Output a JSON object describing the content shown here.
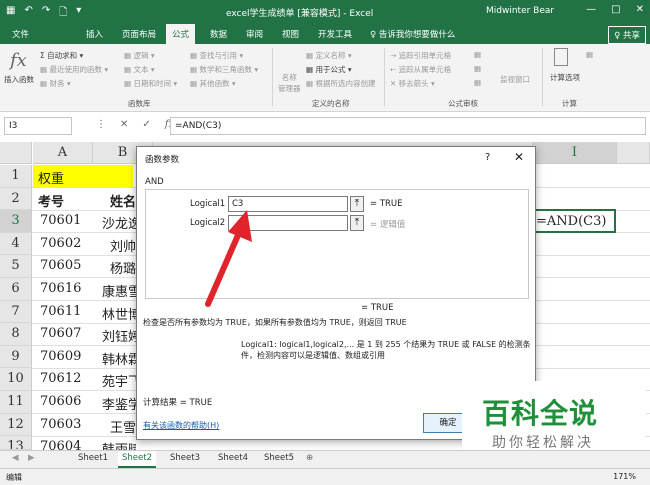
{
  "window": {
    "title": "excel学生成绩单 [兼容模式] - Excel",
    "user": "Midwinter Bear",
    "controls": [
      "—",
      "□",
      "✕"
    ]
  },
  "quick_access": [
    "▦",
    "↶",
    "↷",
    "🗋",
    "▾"
  ],
  "tabs": [
    "文件",
    "插入",
    "页面布局",
    "公式",
    "数据",
    "审阅",
    "视图",
    "开发工具"
  ],
  "active_tab": "公式",
  "tell_me": "♀ 告诉我你想要做什么",
  "share": "♀ 共享",
  "ribbon": {
    "insert_fn": {
      "icon": "fx",
      "label": "插入函数"
    },
    "lib": [
      "Σ 自动求和 ▾",
      "▦ 最近使用的函数 ▾",
      "▦ 财务 ▾",
      "▦ 逻辑 ▾",
      "▦ 文本 ▾",
      "▦ 日期和时间 ▾",
      "▦ 查找与引用 ▾",
      "▦ 数学和三角函数 ▾",
      "▦ 其他函数 ▾"
    ],
    "lib_group": "函数库",
    "name_manager": "名称\n管理器",
    "names": [
      "▦ 定义名称 ▾",
      "▦ 用于公式 ▾",
      "▦ 根据所选内容创建"
    ],
    "names_group": "定义的名称",
    "audit": [
      "⇢ 追踪引用单元格",
      "⇠ 追踪从属单元格",
      "✕ 移去箭头 ▾",
      "▦",
      "▦",
      "▦"
    ],
    "audit_group": "公式审核",
    "watch": "监视窗口",
    "calc_options": "计算选项",
    "calc_group": "计算"
  },
  "namebox": "I3",
  "fx_icons": [
    "⋮",
    "✕",
    "✓",
    "fx"
  ],
  "formula": "=AND(C3)",
  "columns": [
    "A",
    "B",
    "I"
  ],
  "rows": [
    "1",
    "2",
    "3",
    "4",
    "5",
    "6",
    "7",
    "8",
    "9",
    "10",
    "11",
    "12",
    "13"
  ],
  "row1": {
    "a": "权重"
  },
  "header_row": {
    "a": "考号",
    "b": "姓名"
  },
  "data_rows": [
    {
      "a": "70601",
      "b": "沙龙逸"
    },
    {
      "a": "70602",
      "b": "刘帅"
    },
    {
      "a": "70605",
      "b": "杨璐"
    },
    {
      "a": "70616",
      "b": "康惠雪"
    },
    {
      "a": "70611",
      "b": "林世博"
    },
    {
      "a": "70607",
      "b": "刘钰婷"
    },
    {
      "a": "70609",
      "b": "韩林霖"
    },
    {
      "a": "70612",
      "b": "苑宇飞"
    },
    {
      "a": "70606",
      "b": "李鉴学"
    },
    {
      "a": "70603",
      "b": "王雪"
    },
    {
      "a": "70604",
      "b": "韩雨晴"
    }
  ],
  "active_cell": "=AND(C3)",
  "dialog": {
    "title": "函数参数",
    "help": "?",
    "close": "✕",
    "function_name": "AND",
    "args": [
      {
        "label": "Logical1",
        "value": "C3",
        "result": "= TRUE"
      },
      {
        "label": "Logical2",
        "value": "",
        "result": "= 逻辑值"
      }
    ],
    "result_line": "= TRUE",
    "description": "检查是否所有参数均为 TRUE，如果所有参数值均为 TRUE，则返回 TRUE",
    "arg_desc_label": "Logical1:",
    "arg_desc": "logical1,logical2,... 是 1 到 255 个结果为 TRUE 或 FALSE 的检测条件，检测内容可以是逻辑值、数组或引用",
    "calc_result": "计算结果 =  TRUE",
    "help_link": "有关该函数的帮助(H)",
    "ok": "确定"
  },
  "watermark": {
    "title": "百科全说",
    "subtitle": "助你轻松解决"
  },
  "sheet_tabs": [
    "Sheet1",
    "Sheet2",
    "Sheet3",
    "Sheet4",
    "Sheet5"
  ],
  "active_sheet": "Sheet2",
  "status": {
    "mode": "编辑",
    "zoom": "171%"
  },
  "colors": {
    "excel_green": "#217346",
    "highlight": "#ffff00",
    "arrow": "#e0242b"
  }
}
